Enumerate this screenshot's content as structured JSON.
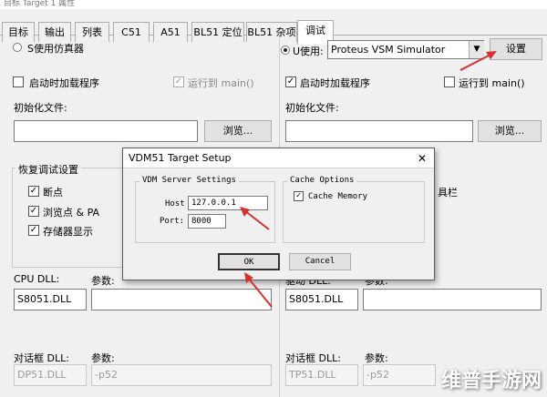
{
  "window": {
    "title": "目标 Target 1 属性"
  },
  "tabs": [
    "目标",
    "输出",
    "列表",
    "C51",
    "A51",
    "BL51 定位",
    "BL51 杂项",
    "调试"
  ],
  "left": {
    "mode_label": "S使用仿真器",
    "load_label": "启动时加载程序",
    "run_main_label": "运行到 main()",
    "init_label": "初始化文件:",
    "browse_label": "浏览...",
    "restore_group": "恢复调试设置",
    "restore_items": [
      "断点",
      "浏览点 & PA",
      "存储器显示"
    ],
    "cpu_dll_label": "CPU DLL:",
    "params_label": "参数:",
    "cpu_dll_value": "S8051.DLL",
    "dialog_dll_label": "对话框 DLL:",
    "dialog_params_label": "参数:",
    "dialog_dll_value": "DP51.DLL",
    "dialog_params_value": "-p52"
  },
  "right": {
    "mode_label": "U使用:",
    "simulator_value": "Proteus VSM Simulator",
    "settings_label": "设置",
    "load_label": "启动时加载程序",
    "run_main_label": "运行到 main()",
    "init_label": "初始化文件:",
    "browse_label": "浏览...",
    "toolbar_fragment": "具栏",
    "cpu_dll_label": "驱动 DLL:",
    "params_label": "参数:",
    "cpu_dll_value": "S8051.DLL",
    "dialog_dll_label": "对话框 DLL:",
    "dialog_params_label": "参数:",
    "dialog_dll_value": "TP51.DLL",
    "dialog_params_value": "-p52"
  },
  "dialog": {
    "title": "VDM51 Target Setup",
    "close": "✕",
    "server_group": "VDM Server Settings",
    "host_label": "Host",
    "host_value": "127.0.0.1",
    "port_label": "Port:",
    "port_value": "8000",
    "cache_group": "Cache Options",
    "cache_memory_label": "Cache Memory",
    "ok_label": "OK",
    "cancel_label": "Cancel"
  },
  "watermark": "维普手游网",
  "colors": {
    "annotation_arrow": "#d83030",
    "active_tab": "#ffffff"
  }
}
